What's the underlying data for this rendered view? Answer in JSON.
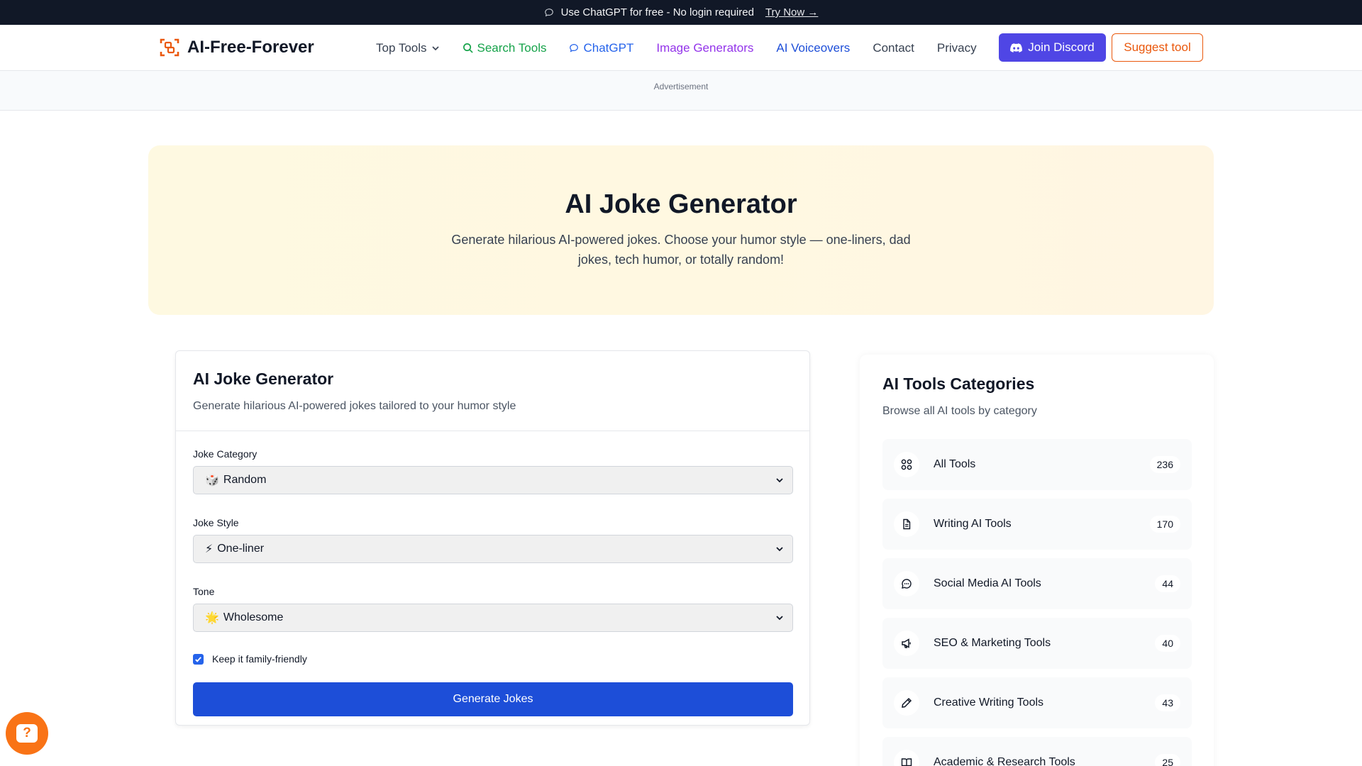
{
  "banner": {
    "text": "Use ChatGPT for free - No login required",
    "link": "Try Now →"
  },
  "header": {
    "brand": "AI-Free-Forever",
    "menu": [
      {
        "label": "Top Tools",
        "icon": "chevron-down-icon"
      },
      {
        "label": "Search Tools",
        "icon": "search-icon"
      },
      {
        "label": "ChatGPT",
        "icon": "chat-bubble-icon"
      },
      {
        "label": "Image Generators"
      },
      {
        "label": "AI Voiceovers"
      },
      {
        "label": "Contact"
      },
      {
        "label": "Privacy"
      }
    ],
    "discord_label": "Join Discord",
    "suggest_label": "Suggest tool"
  },
  "ad": {
    "label": "Advertisement"
  },
  "hero": {
    "title": "AI Joke Generator",
    "description": "Generate hilarious AI-powered jokes. Choose your humor style — one-liners, dad jokes, tech humor, or totally random!"
  },
  "generator": {
    "title": "AI Joke Generator",
    "subtitle": "Generate hilarious AI-powered jokes tailored to your humor style",
    "fields": [
      {
        "label": "Joke Category",
        "emoji": "🎲",
        "value": "Random"
      },
      {
        "label": "Joke Style",
        "emoji": "⚡",
        "value": "One-liner"
      },
      {
        "label": "Tone",
        "emoji": "🌟",
        "value": "Wholesome"
      }
    ],
    "checkbox_label": "Keep it family-friendly",
    "checkbox_checked": true,
    "button_label": "Generate Jokes"
  },
  "categories": {
    "title": "AI Tools Categories",
    "subtitle": "Browse all AI tools by category",
    "items": [
      {
        "label": "All Tools",
        "count": "236",
        "icon": "grid-icon"
      },
      {
        "label": "Writing AI Tools",
        "count": "170",
        "icon": "document-icon"
      },
      {
        "label": "Social Media AI Tools",
        "count": "44",
        "icon": "chat-icon"
      },
      {
        "label": "SEO & Marketing Tools",
        "count": "40",
        "icon": "megaphone-icon"
      },
      {
        "label": "Creative Writing Tools",
        "count": "43",
        "icon": "pencil-icon"
      },
      {
        "label": "Academic & Research Tools",
        "count": "25",
        "icon": "book-icon"
      }
    ]
  },
  "colors": {
    "accent_orange": "#ea580c",
    "discord": "#4f46e5",
    "primary_button": "#1d4ed8"
  }
}
